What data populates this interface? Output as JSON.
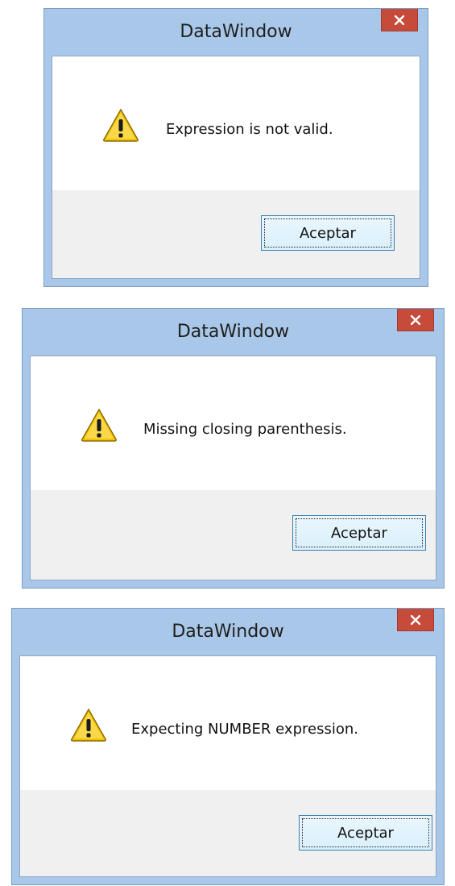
{
  "dialogs": [
    {
      "title": "DataWindow",
      "message": "Expression is not valid.",
      "ok_label": "Aceptar",
      "close_icon": "close-icon",
      "message_icon": "warning-icon"
    },
    {
      "title": "DataWindow",
      "message": "Missing closing parenthesis.",
      "ok_label": "Aceptar",
      "close_icon": "close-icon",
      "message_icon": "warning-icon"
    },
    {
      "title": "DataWindow",
      "message": "Expecting NUMBER expression.",
      "ok_label": "Aceptar",
      "close_icon": "close-icon",
      "message_icon": "warning-icon"
    }
  ],
  "colors": {
    "frame": "#a9c7e8",
    "close_button": "#c74b3a",
    "client_background": "#ffffff",
    "button_area": "#f0f0f0",
    "ok_border": "#3c7fb1"
  }
}
